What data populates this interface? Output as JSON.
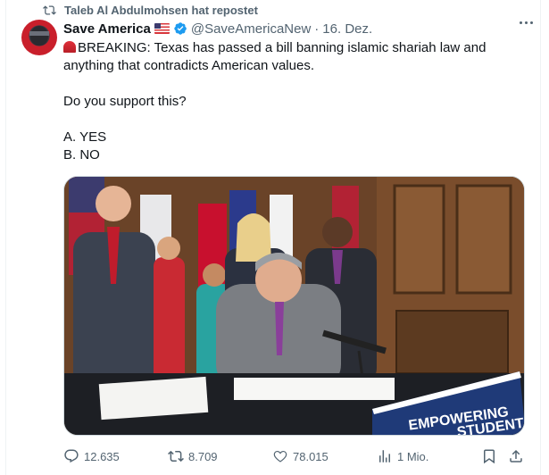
{
  "repost": {
    "label": "Taleb Al Abdulmohsen hat repostet",
    "icon": "repost-icon"
  },
  "author": {
    "name": "Save America",
    "handle": "@SaveAmericaNew",
    "separator": "·",
    "date": "16. Dez.",
    "verified": true,
    "flag": "us-flag-icon"
  },
  "tweet": {
    "line1": "BREAKING: Texas has passed a bill banning islamic shariah law and anything that contradicts American values.",
    "question": "Do you support this?",
    "option_a": "A. YES",
    "option_b": "B. NO"
  },
  "media": {
    "banner_line1": "EMPOWERING",
    "banner_line2": "STUDENTS"
  },
  "actions": {
    "replies": "12.635",
    "reposts": "8.709",
    "likes": "78.015",
    "views": "1 Mio."
  },
  "colors": {
    "accent": "#1d9bf0",
    "muted": "#536471",
    "text": "#0f1419"
  }
}
